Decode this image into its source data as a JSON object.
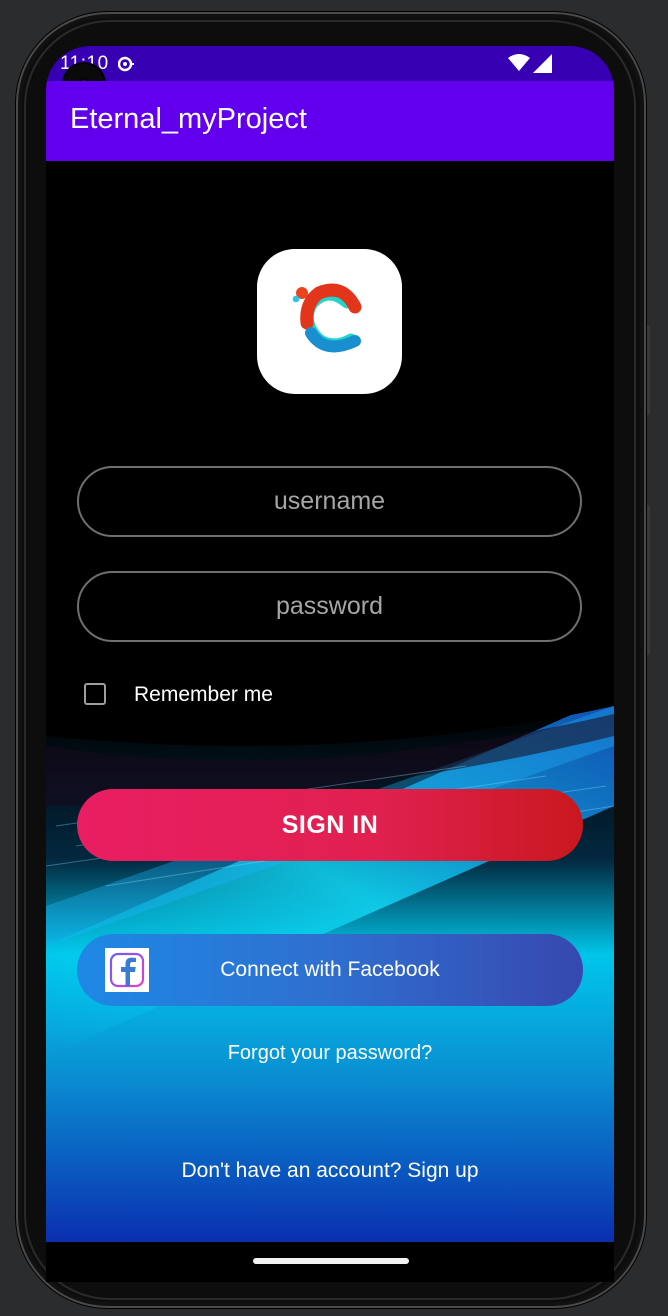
{
  "status_bar": {
    "time": "11:10"
  },
  "app_bar": {
    "title": "Eternal_myProject"
  },
  "login": {
    "username_placeholder": "username",
    "password_placeholder": "password",
    "remember_label": "Remember me",
    "remember_checked": false,
    "signin_label": "SIGN IN",
    "facebook_label": "Connect with Facebook",
    "forgot_label": "Forgot your password?",
    "signup_label": "Don't have an account? Sign up"
  },
  "icons": {
    "logo": "app-logo-c-icon",
    "facebook": "facebook-icon",
    "wifi": "wifi-icon",
    "signal": "signal-icon",
    "camera": "front-camera"
  },
  "colors": {
    "status_bar": "#3700b3",
    "app_bar": "#6200ee",
    "signin_start": "#e91e63",
    "signin_end": "#c9181f",
    "facebook_start": "#1e88e5",
    "facebook_end": "#3748b0"
  }
}
